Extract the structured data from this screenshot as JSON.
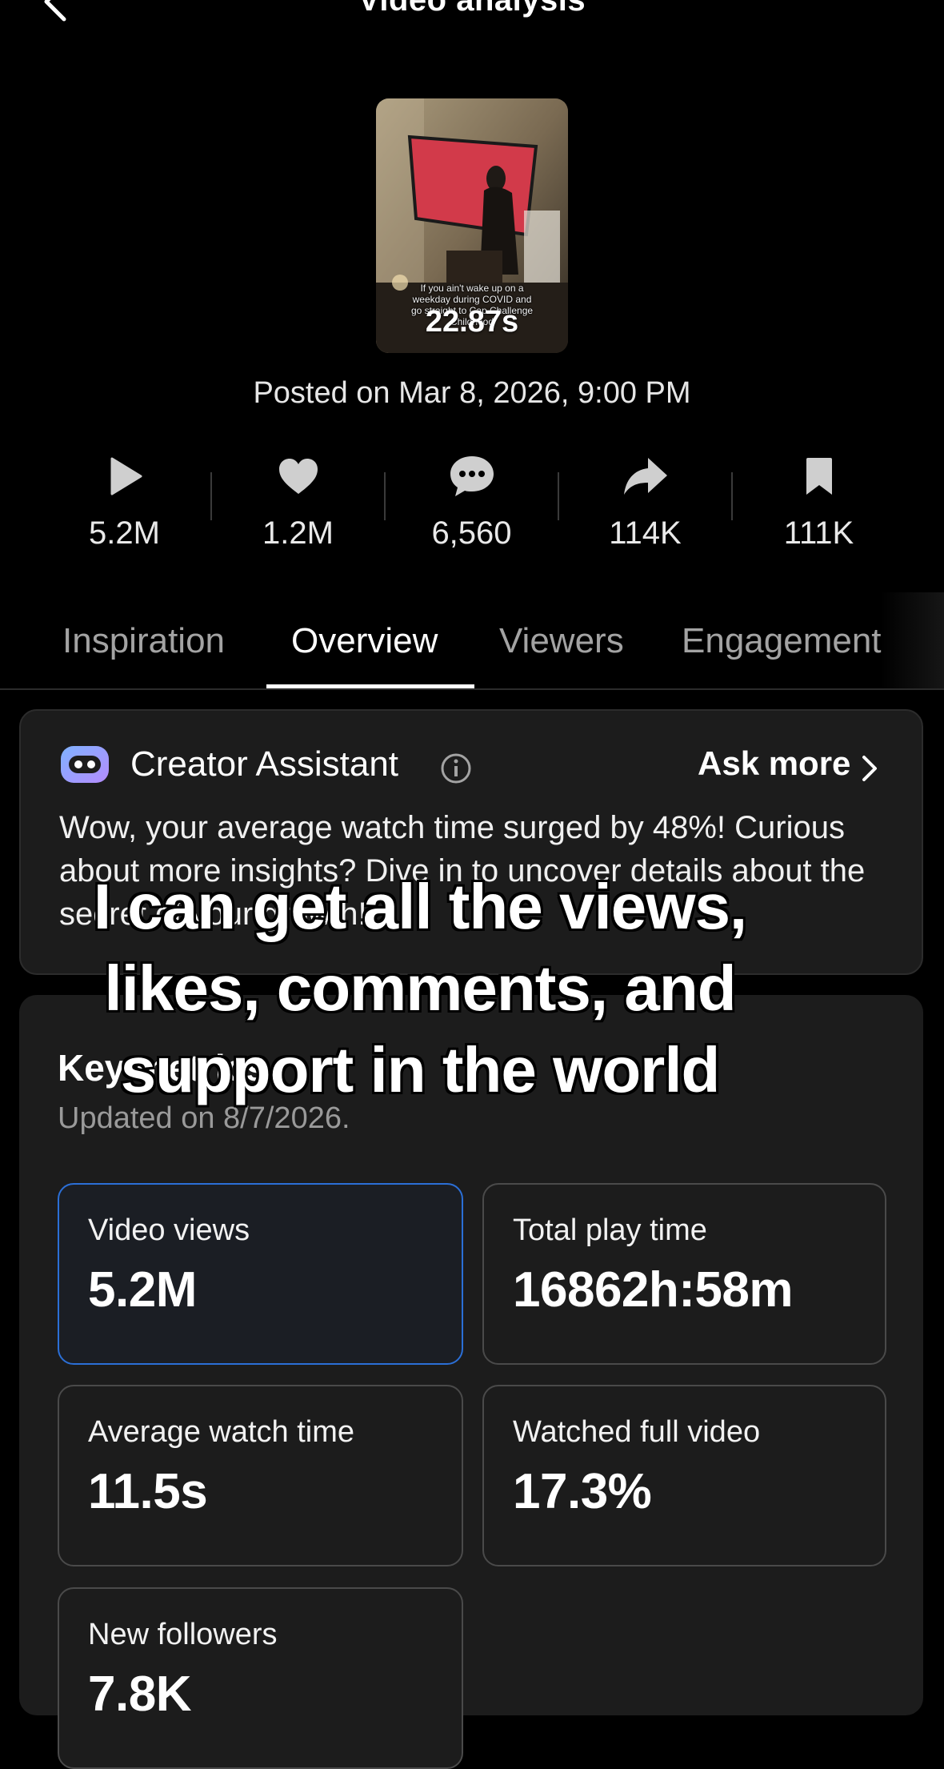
{
  "header": {
    "title": "Video analysis"
  },
  "video": {
    "thumbnail_caption": "If you ain't wake up on a weekday during COVID and go straight to Cap Challenge Childhood",
    "duration": "22.87s",
    "posted": "Posted on Mar 8, 2026, 9:00 PM"
  },
  "stats": [
    {
      "icon": "play-icon",
      "value": "5.2M"
    },
    {
      "icon": "heart-icon",
      "value": "1.2M"
    },
    {
      "icon": "comment-icon",
      "value": "6,560"
    },
    {
      "icon": "share-icon",
      "value": "114K"
    },
    {
      "icon": "bookmark-icon",
      "value": "111K"
    }
  ],
  "tabs": [
    {
      "label": "Inspiration",
      "active": false
    },
    {
      "label": "Overview",
      "active": true
    },
    {
      "label": "Viewers",
      "active": false
    },
    {
      "label": "Engagement",
      "active": false
    }
  ],
  "assistant": {
    "title": "Creator Assistant",
    "ask_more": "Ask more",
    "body": "Wow, your average watch time surged by 48%! Curious about more insights? Dive in to uncover details about the secret of your growth!"
  },
  "key_metrics": {
    "title": "Key metrics",
    "updated": "Updated on 8/7/2026.",
    "items": [
      {
        "label": "Video views",
        "value": "5.2M",
        "selected": true
      },
      {
        "label": "Total play time",
        "value": "16862h:58m",
        "selected": false
      },
      {
        "label": "Average watch time",
        "value": "11.5s",
        "selected": false
      },
      {
        "label": "Watched full video",
        "value": "17.3%",
        "selected": false
      },
      {
        "label": "New followers",
        "value": "7.8K",
        "selected": false
      }
    ]
  },
  "overlay_caption": "I can get all the views, likes, comments, and support in the world",
  "colors": {
    "background": "#000000",
    "card": "#1c1c1c",
    "selected_border": "#2b6fd6",
    "muted_text": "#a3a3a3"
  }
}
